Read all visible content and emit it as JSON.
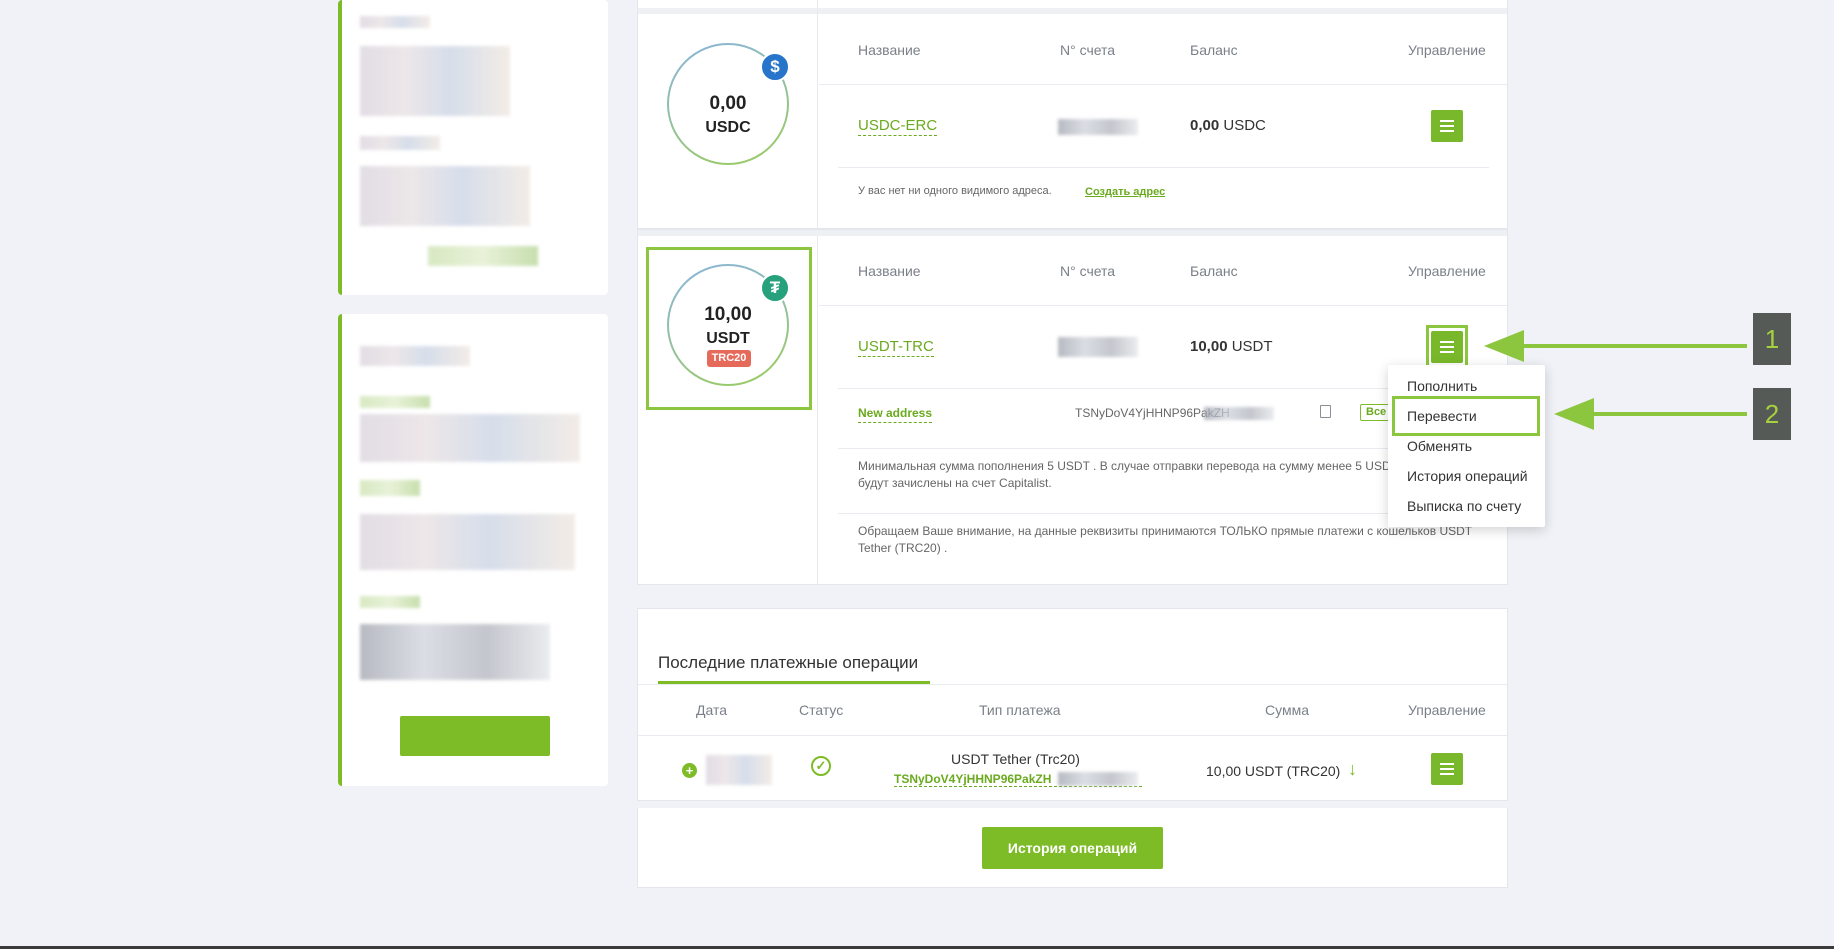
{
  "accounts": [
    {
      "amount": "0,00",
      "currency": "USDC",
      "headers": {
        "name": "Название",
        "account_no": "N° счета",
        "balance": "Баланс",
        "control": "Управление"
      },
      "name": "USDC-ERC",
      "balance_value": "0,00",
      "balance_currency": "USDC",
      "notice": "У вас нет ни одного видимого адреса.",
      "create_link": "Создать адрес",
      "coin_icon": "dollar-coin-icon",
      "coin_color": "#2775ca"
    },
    {
      "amount": "10,00",
      "currency": "USDT",
      "network_badge": "TRC20",
      "headers": {
        "name": "Название",
        "account_no": "N° счета",
        "balance": "Баланс",
        "control": "Управление"
      },
      "name": "USDT-TRC",
      "balance_value": "10,00",
      "balance_currency": "USDT",
      "address_label": "New address",
      "address_value": "TSNyDoV4YjHHNP96PakZH",
      "all_button": "Все",
      "info1": "Минимальная сумма пополнения 5 USDT . В случае отправки перевода на сумму менее 5 USDT",
      "info1b": "будут зачислены на счет Capitalist.",
      "info2": "Обращаем Ваше внимание, на данные реквизиты принимаются ТОЛЬКО прямые платежи с кошельков USDT",
      "info2b": "Tether (TRC20) .",
      "coin_icon": "tether-icon",
      "coin_color": "#26a17b"
    }
  ],
  "dropdown": {
    "items": [
      "Пополнить",
      "Перевести",
      "Обменять",
      "История операций",
      "Выписка по счету"
    ]
  },
  "callouts": [
    "1",
    "2"
  ],
  "recent": {
    "title": "Последние платежные операции",
    "headers": {
      "date": "Дата",
      "status": "Статус",
      "type": "Тип платежа",
      "amount": "Сумма",
      "control": "Управление"
    },
    "row": {
      "type_title": "USDT Tether (Trc20)",
      "type_address": "TSNyDoV4YjHHNP96PakZH",
      "amount": "10,00 USDT (TRC20)"
    },
    "history_button": "История операций"
  },
  "colors": {
    "accent": "#7dbb27",
    "highlight": "#8cc63f",
    "badge_bg": "#555a56",
    "trc_badge": "#e66a5a"
  }
}
